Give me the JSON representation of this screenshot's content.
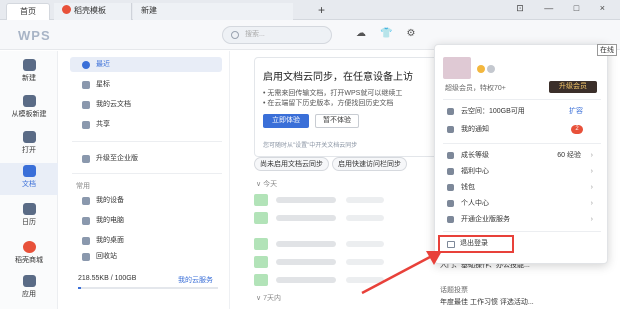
{
  "tabs": {
    "home": "首页",
    "template": "稻壳模板",
    "new": "新建",
    "add": "+"
  },
  "window": {
    "controls": "⊡ — □ ×",
    "online_tip": "在线"
  },
  "toolbar": {
    "logo": "WPS",
    "search_placeholder": "搜索...",
    "icons": [
      "cloud-sync-icon",
      "shirt-icon",
      "settings-icon"
    ]
  },
  "sidebar": {
    "items": [
      {
        "label": "新建",
        "icon": "plus-icon"
      },
      {
        "label": "从模板新建",
        "icon": "template-icon"
      },
      {
        "label": "打开",
        "icon": "folder-icon"
      },
      {
        "label": "文档",
        "icon": "document-icon"
      },
      {
        "label": "日历",
        "icon": "calendar-icon"
      },
      {
        "label": "稻壳商城",
        "icon": "store-icon"
      },
      {
        "label": "应用",
        "icon": "apps-icon"
      }
    ]
  },
  "nav": {
    "recent": "最近",
    "starred": "星标",
    "cloud_docs": "我的云文档",
    "shared": "共享",
    "enterprise": "升级至企业版",
    "common_label": "常用",
    "devices": "我的设备",
    "computer": "我的电脑",
    "desktop": "我的桌面",
    "recycle": "回收站",
    "storage": "218.55KB / 100GB",
    "storage_link": "我的云服务",
    "storage_fraction": 0.02
  },
  "card": {
    "title": "启用文档云同步，在任意设备上访",
    "line1": "• 无需来回传输文档，打开WPS就可以继续工",
    "line2": "• 在云端留下历史版本，方便找回历史文档",
    "enable": "立即体验",
    "later": "暂不体验",
    "hint": "您可随时从\"设置\"中开关文档云同步"
  },
  "chips": {
    "c1": "尚未启用文档云同步",
    "c2": "启用快速访问栏同步"
  },
  "groups": {
    "today": "今天",
    "week": "7天内"
  },
  "right_col": {
    "line1": "入门、基础操作、办公技能...",
    "label": "话题投票",
    "line2": "年度最佳 工作习惯 评选活动..."
  },
  "popup": {
    "member_text": "超级会员，特权70+",
    "upgrade": "升级会员",
    "items": [
      {
        "label": "云空间：100GB可用",
        "extra": "扩容"
      },
      {
        "label": "我的通知",
        "badge": "2"
      },
      {
        "label": "成长等级",
        "value": "60 经验"
      },
      {
        "label": "福利中心"
      },
      {
        "label": "钱包"
      },
      {
        "label": "个人中心"
      },
      {
        "label": "开通企业版服务"
      }
    ],
    "logout": "退出登录"
  },
  "colors": {
    "accent": "#3a6fd8",
    "highlight": "#e8413a"
  }
}
